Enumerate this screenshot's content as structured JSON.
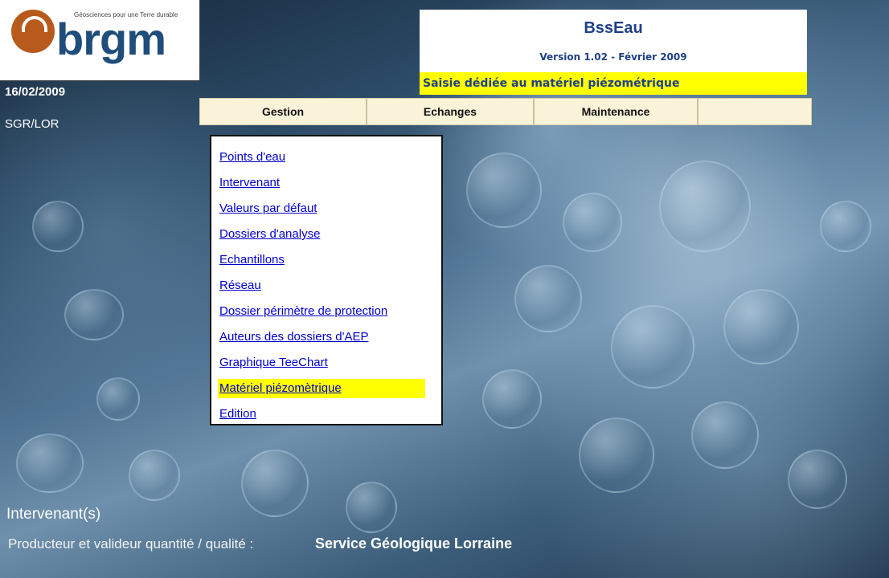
{
  "logo": {
    "tagline": "Géosciences pour une Terre durable",
    "wordmark": "brgm"
  },
  "sidebar": {
    "date": "16/02/2009",
    "user": "SGR/LOR"
  },
  "header": {
    "title": "BssEau",
    "version": "Version 1.02 - Février 2009",
    "subtitle": "Saisie dédiée au matériel piézométrique"
  },
  "menubar": {
    "tabs": [
      {
        "label": "Gestion"
      },
      {
        "label": "Echanges"
      },
      {
        "label": "Maintenance"
      },
      {
        "label": ""
      }
    ]
  },
  "dropdown": {
    "items": [
      {
        "label": "Points d'eau"
      },
      {
        "label": "Intervenant"
      },
      {
        "label": "Valeurs par défaut"
      },
      {
        "label": "Dossiers d'analyse"
      },
      {
        "label": "Echantillons"
      },
      {
        "label": "Réseau"
      },
      {
        "label": "Dossier périmètre de protection"
      },
      {
        "label": "Auteurs des dossiers d'AEP"
      },
      {
        "label": "Graphique TeeChart"
      },
      {
        "label": "Matériel piézomètrique",
        "active": true
      },
      {
        "label": "Edition"
      }
    ]
  },
  "footer": {
    "label": "Intervenant(s)",
    "role": "Producteur et valideur quantité / qualité :",
    "organization": "Service Géologique Lorraine"
  },
  "colors": {
    "highlight": "#ffff00",
    "link": "#0000cc",
    "header_text": "#1f3f88",
    "menubar_bg": "#faf3d9"
  }
}
